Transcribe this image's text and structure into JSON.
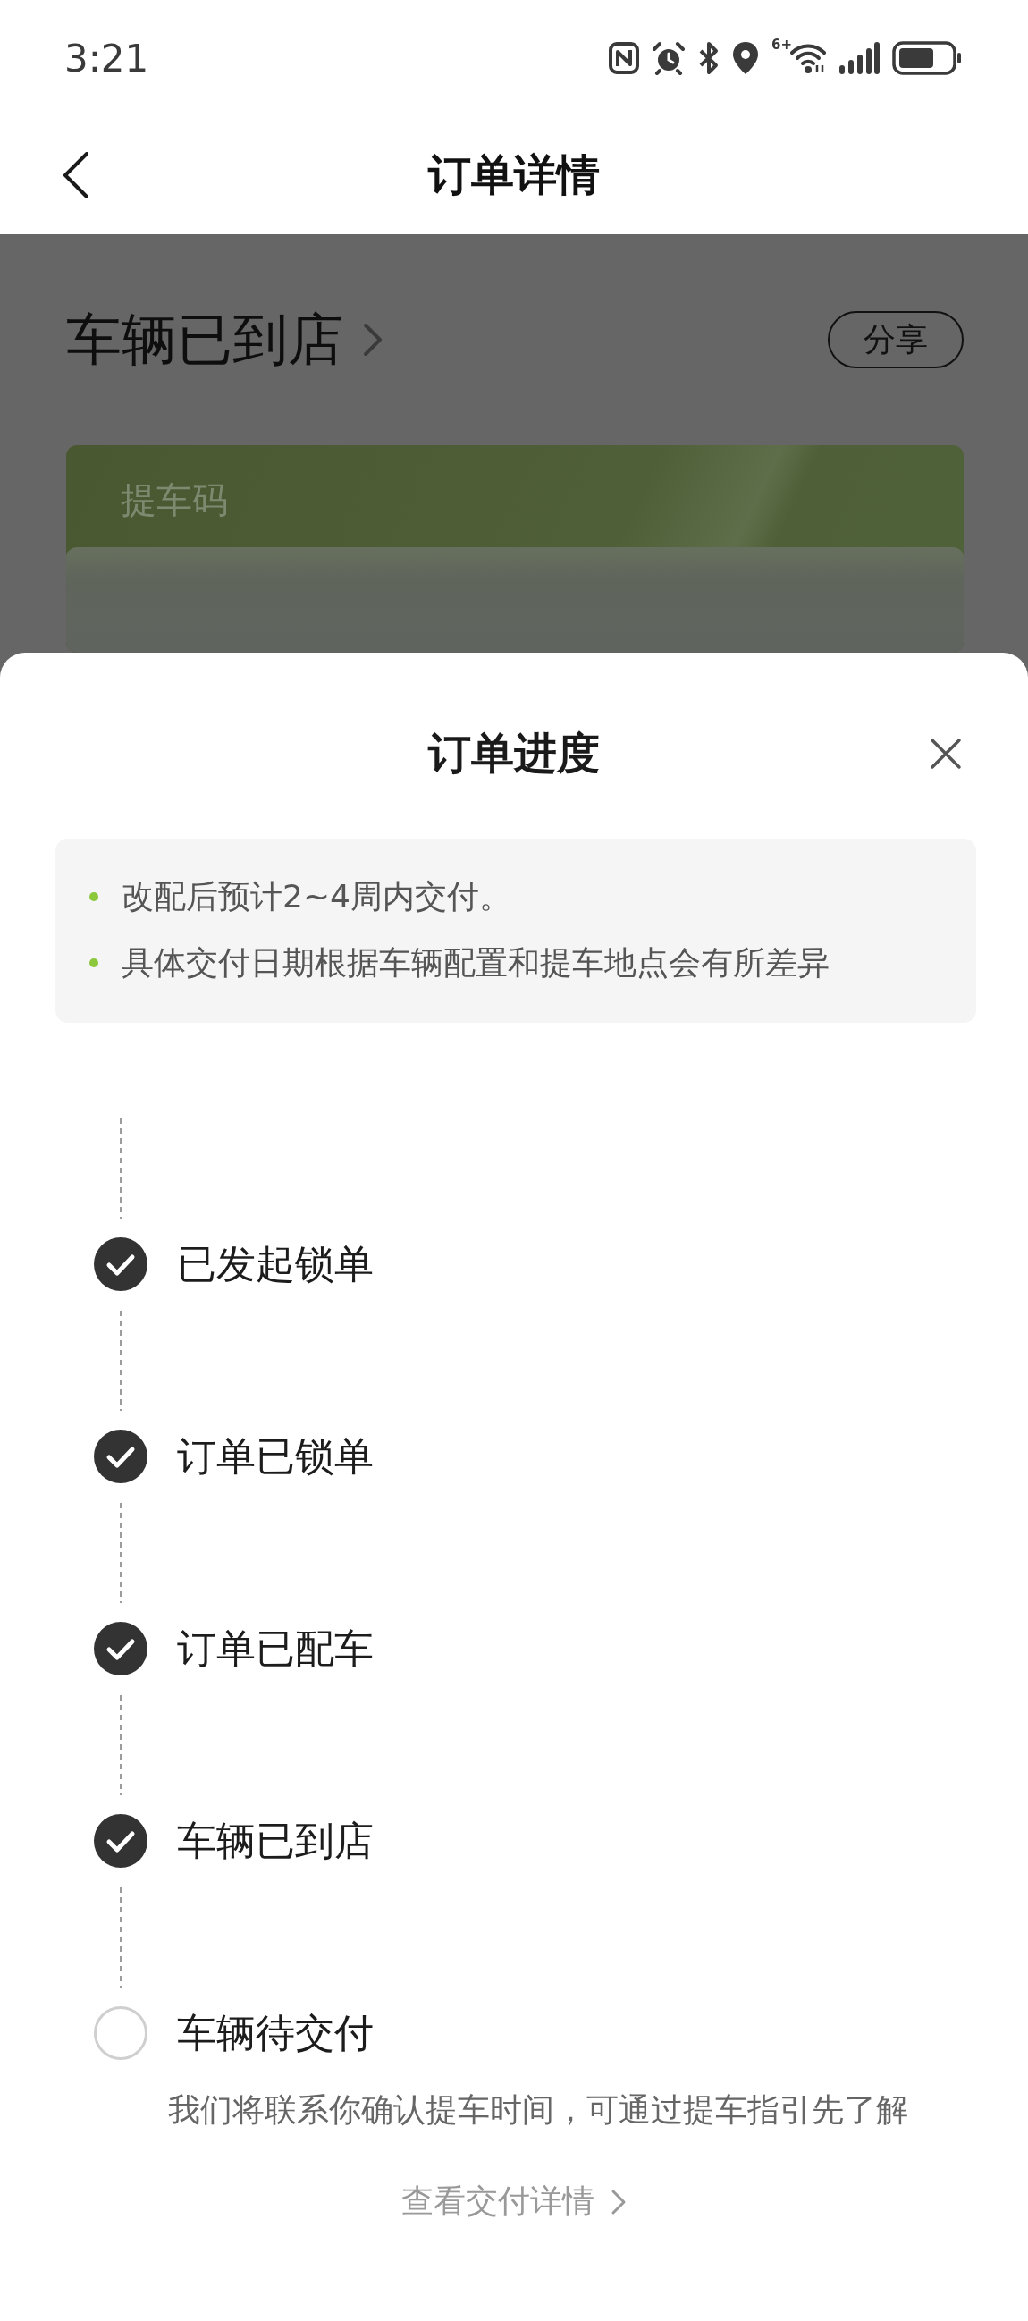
{
  "status_bar": {
    "time": "3:21",
    "wifi_badge": "6+"
  },
  "header": {
    "title": "订单详情"
  },
  "order": {
    "status": "车辆已到店",
    "share": "分享",
    "pickup_card": {
      "label": "提车码"
    }
  },
  "sheet": {
    "title": "订单进度",
    "notices": [
      "改配后预计2~4周内交付。",
      "具体交付日期根据车辆配置和提车地点会有所差异"
    ],
    "steps": [
      {
        "label": "已发起锁单",
        "done": true
      },
      {
        "label": "订单已锁单",
        "done": true
      },
      {
        "label": "订单已配车",
        "done": true
      },
      {
        "label": "车辆已到店",
        "done": true
      },
      {
        "label": "车辆待交付",
        "done": false,
        "description": "我们将联系你确认提车时间，可通过提车指引先了解"
      }
    ],
    "detail_link": "查看交付详情"
  }
}
